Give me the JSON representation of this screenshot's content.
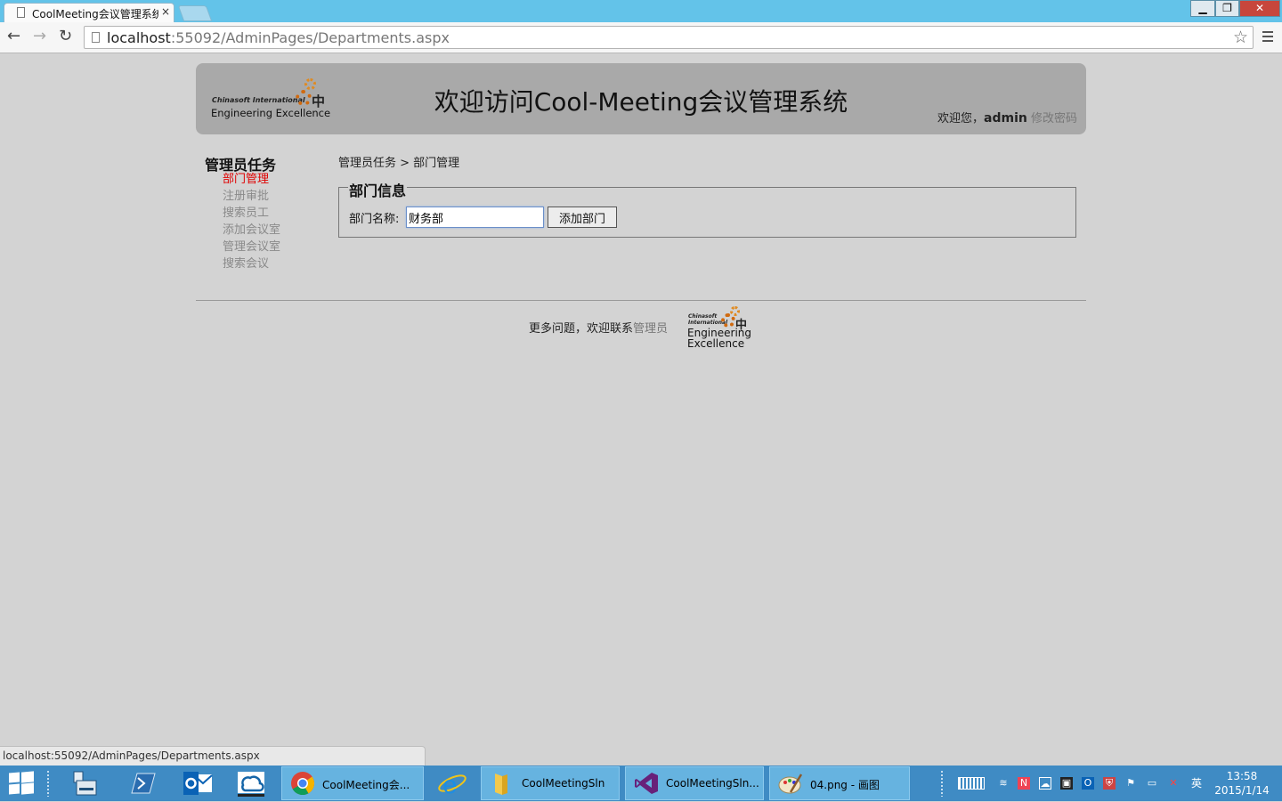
{
  "browser": {
    "tab_title": "CoolMeeting会议管理系统",
    "tab_close": "×",
    "window_buttons": {
      "minimize": "▁",
      "maximize": "❐",
      "close": "✕"
    },
    "nav": {
      "back": "←",
      "forward": "→",
      "reload": "↻"
    },
    "url_host": "localhost",
    "url_rest": ":55092/AdminPages/Departments.aspx",
    "star": "☆",
    "status_url": "localhost:55092/AdminPages/Departments.aspx"
  },
  "header": {
    "logo_small": "Chinasoft International",
    "logo_big": "Engineering Excellence",
    "logo_char": "中",
    "title": "欢迎访问Cool-Meeting会议管理系统",
    "welcome_prefix": "欢迎您，",
    "username": "admin",
    "change_password": "修改密码"
  },
  "sidebar": {
    "title": "管理员任务",
    "items": [
      {
        "label": "部门管理",
        "active": true
      },
      {
        "label": "注册审批"
      },
      {
        "label": "搜索员工"
      },
      {
        "label": "添加会议室"
      },
      {
        "label": "管理会议室"
      },
      {
        "label": "搜索会议"
      }
    ]
  },
  "breadcrumb": "管理员任务 > 部门管理",
  "form": {
    "legend": "部门信息",
    "label": "部门名称:",
    "value": "财务部",
    "button": "添加部门"
  },
  "footer": {
    "text": "更多问题，欢迎联系",
    "link": "管理员",
    "logo_small_1": "Chinasoft",
    "logo_small_2": "International",
    "logo_big_1": "Engineering",
    "logo_big_2": "Excellence",
    "logo_char": "中"
  },
  "taskbar": {
    "buttons": [
      {
        "label": "CoolMeeting会..."
      },
      {
        "label": "CoolMeetingSln"
      },
      {
        "label": "CoolMeetingSln..."
      },
      {
        "label": "04.png - 画图"
      }
    ],
    "ime": "英",
    "time": "13:58",
    "date": "2015/1/14"
  },
  "colors": {
    "active_nav": "#e00000",
    "link_gray": "#777777",
    "header_bg": "#a9a9a9",
    "page_bg": "#d3d3d3",
    "taskbar": "#3f8bc4"
  }
}
